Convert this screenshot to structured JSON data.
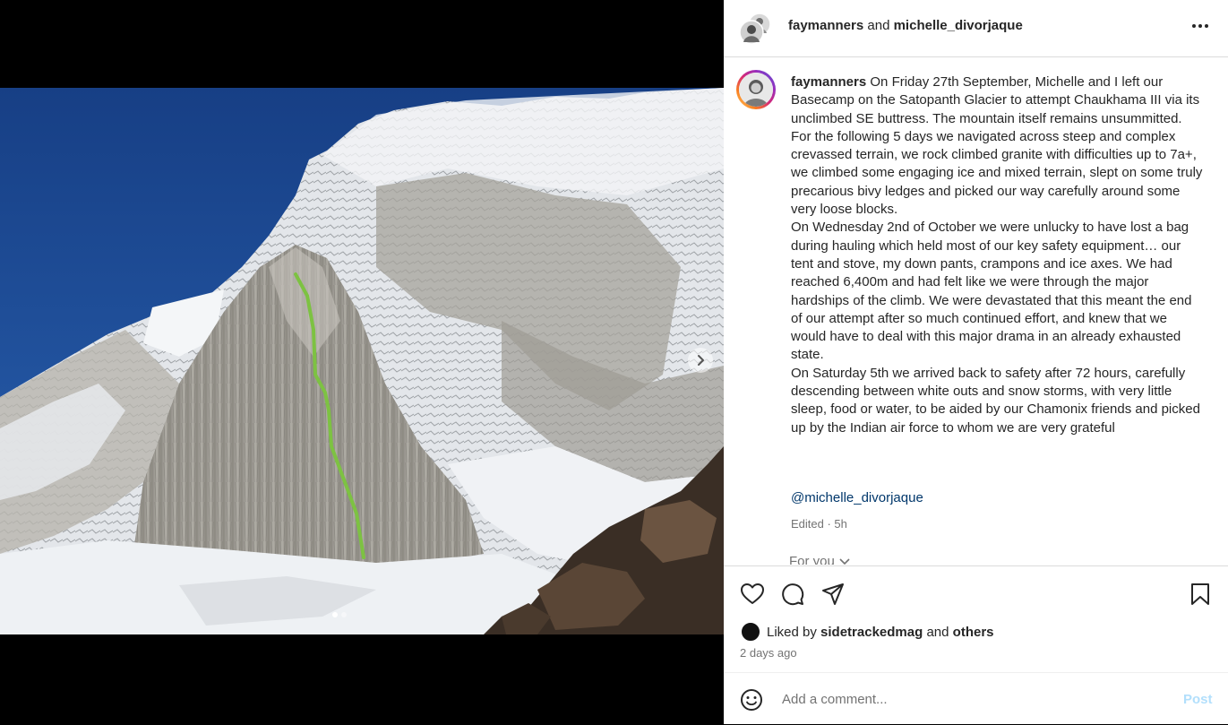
{
  "header": {
    "user1": "faymanners",
    "joiner": " and ",
    "user2": "michelle_divorjaque"
  },
  "caption": {
    "username": "faymanners",
    "paragraphs": [
      "On Friday 27th September, Michelle and I left our Basecamp on the Satopanth Glacier to attempt Chaukhama III via its unclimbed SE buttress. The mountain itself remains unsummitted.",
      "For the following 5 days we navigated across steep and complex crevassed terrain, we rock climbed granite with difficulties up to 7a+, we climbed some engaging ice and mixed terrain, slept on some truly precarious bivy ledges and picked our way carefully around some very loose blocks.",
      "On Wednesday 2nd of October we were unlucky to have lost a bag during hauling which held most of our key safety equipment… our tent and stove, my down pants, crampons and ice axes. We had reached 6,400m and had felt like we were through the major hardships of the climb. We were devastated that this meant the end of our attempt after so much continued effort, and knew that we would have to deal with this major drama in an already exhausted state.",
      "On Saturday 5th we arrived back to safety after 72 hours, carefully descending between white outs and snow storms, with very little sleep, food or water, to be aided by our Chamonix friends and picked up by the Indian air force to whom we are very grateful"
    ],
    "mention": "@michelle_divorjaque",
    "meta": "Edited · 5h"
  },
  "for_you": "For you",
  "likes": {
    "prefix": "Liked by ",
    "user": "sidetrackedmag",
    "middle": " and ",
    "others": "others"
  },
  "posted_time": "2 days ago",
  "comment_box": {
    "placeholder": "Add a comment...",
    "post_label": "Post"
  },
  "carousel": {
    "total_slides": 2,
    "active_slide": 1
  },
  "icons": {
    "more": "more-options-icon",
    "like": "heart-icon",
    "comment": "comment-icon",
    "share": "send-icon",
    "save": "bookmark-icon",
    "emoji": "emoji-icon",
    "next": "chevron-right-icon"
  },
  "colors": {
    "route_line": "#7dc242",
    "link": "#00376b",
    "post_disabled": "#b2dffc",
    "sky": "#1e4f99"
  }
}
